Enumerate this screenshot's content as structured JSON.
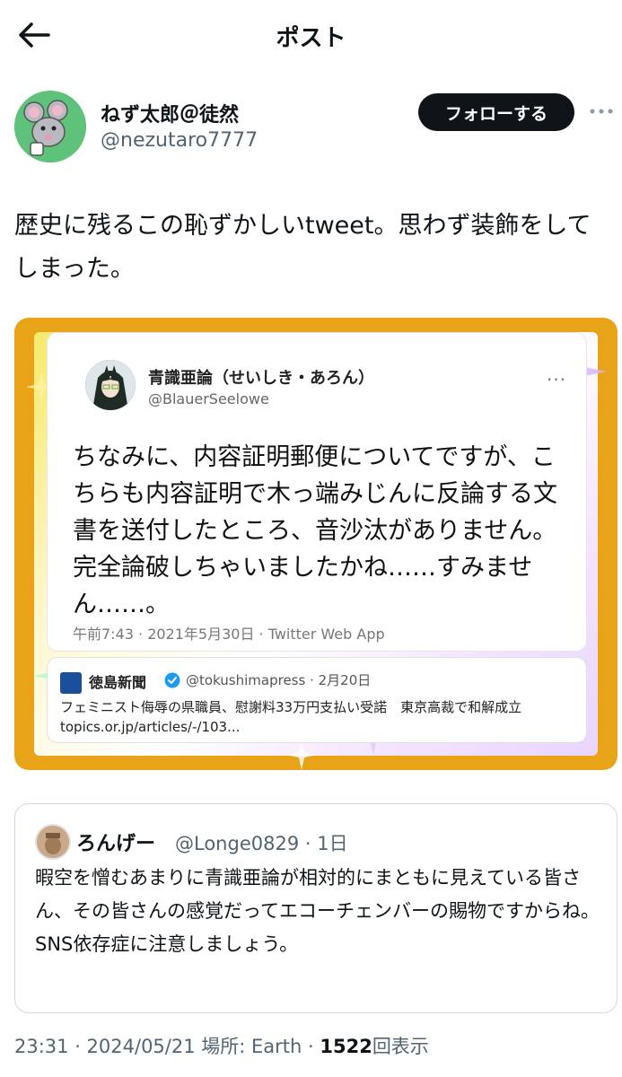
{
  "header": {
    "title": "ポスト",
    "back_icon": "arrow-left-icon"
  },
  "author": {
    "name": "ねず太郎＠徒然",
    "handle": "@nezutaro7777",
    "follow_label": "フォローする",
    "more_icon": "ellipsis-icon"
  },
  "post": {
    "text": "歴史に残るこの恥ずかしいtweet。思わず装飾をしてしまった。"
  },
  "embedded_image": {
    "tweet": {
      "name": "青識亜論（せいしき・あろん）",
      "handle": "@BlauerSeelowe",
      "more": "···",
      "text": "ちなみに、内容証明郵便についてですが、こちらも内容証明で木っ端みじんに反論する文書を送付したところ、音沙汰がありません。完全論破しちゃいましたかね……すみません……。",
      "meta": "午前7:43 · 2021年5月30日 · Twitter Web App"
    },
    "quoted_news": {
      "name": "徳島新聞",
      "handle": "@tokushimapress · 2月20日",
      "line1": "フェミニスト侮辱の県職員、慰謝料33万円支払い受諾　東京高裁で和解成立",
      "line2": "topics.or.jp/articles/-/103..."
    }
  },
  "quote": {
    "name": "ろんげー",
    "handle": "@Longe0829 · 1日",
    "text": "暇空を憎むあまりに青識亜論が相対的にまともに見えている皆さん、その皆さんの感覚だってエコーチェンバーの賜物ですからね。SNS依存症に注意しましょう。"
  },
  "footer": {
    "time": "23:31 · 2024/05/21 場所: Earth · ",
    "views": "1522",
    "views_label": "回表示"
  },
  "colors": {
    "accent": "#0f1419",
    "muted": "#536471",
    "frame": "#e8a319"
  }
}
